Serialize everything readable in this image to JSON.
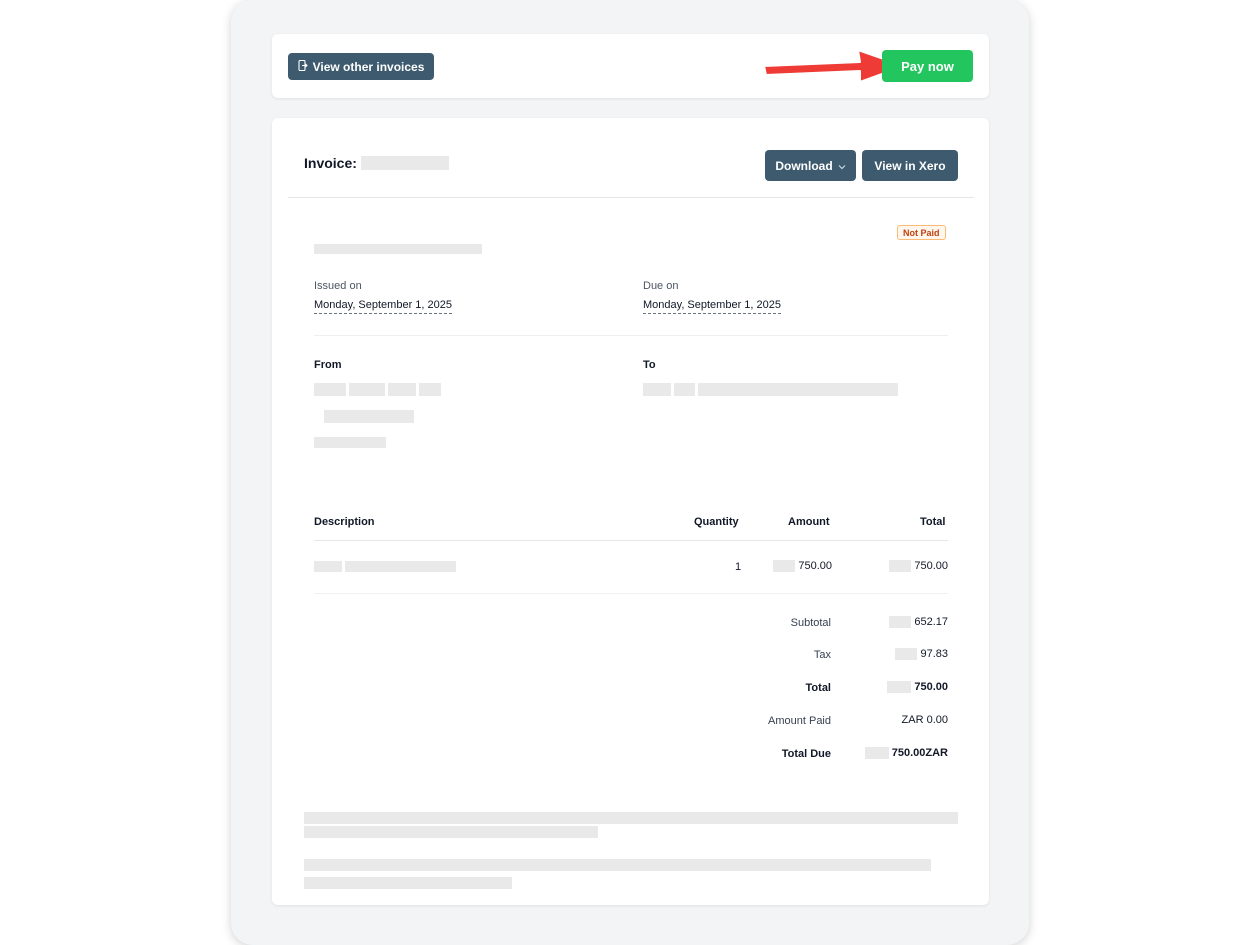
{
  "topbar": {
    "view_other_label": "View other invoices",
    "pay_now_label": "Pay now"
  },
  "invoice": {
    "title_label": "Invoice:",
    "download_label": "Download",
    "view_xero_label": "View in Xero",
    "status": "Not Paid",
    "issued_label": "Issued on",
    "issued_date": "Monday, September 1, 2025",
    "due_label": "Due on",
    "due_date": "Monday, September 1, 2025",
    "from_label": "From",
    "to_label": "To"
  },
  "table": {
    "headers": {
      "description": "Description",
      "quantity": "Quantity",
      "amount": "Amount",
      "total": "Total"
    },
    "rows": [
      {
        "quantity": "1",
        "amount": "750.00",
        "total": "750.00"
      }
    ]
  },
  "totals": {
    "subtotal_label": "Subtotal",
    "subtotal_value": "652.17",
    "tax_label": "Tax",
    "tax_value": "97.83",
    "total_label": "Total",
    "total_value": "750.00",
    "amount_paid_label": "Amount Paid",
    "amount_paid_value": "ZAR 0.00",
    "total_due_label": "Total Due",
    "total_due_value": "750.00ZAR"
  },
  "colors": {
    "primary_button": "#3d5a6e",
    "pay_button": "#22c55e",
    "status_badge": "#c2410c",
    "annotation_arrow": "#ef3b36"
  }
}
